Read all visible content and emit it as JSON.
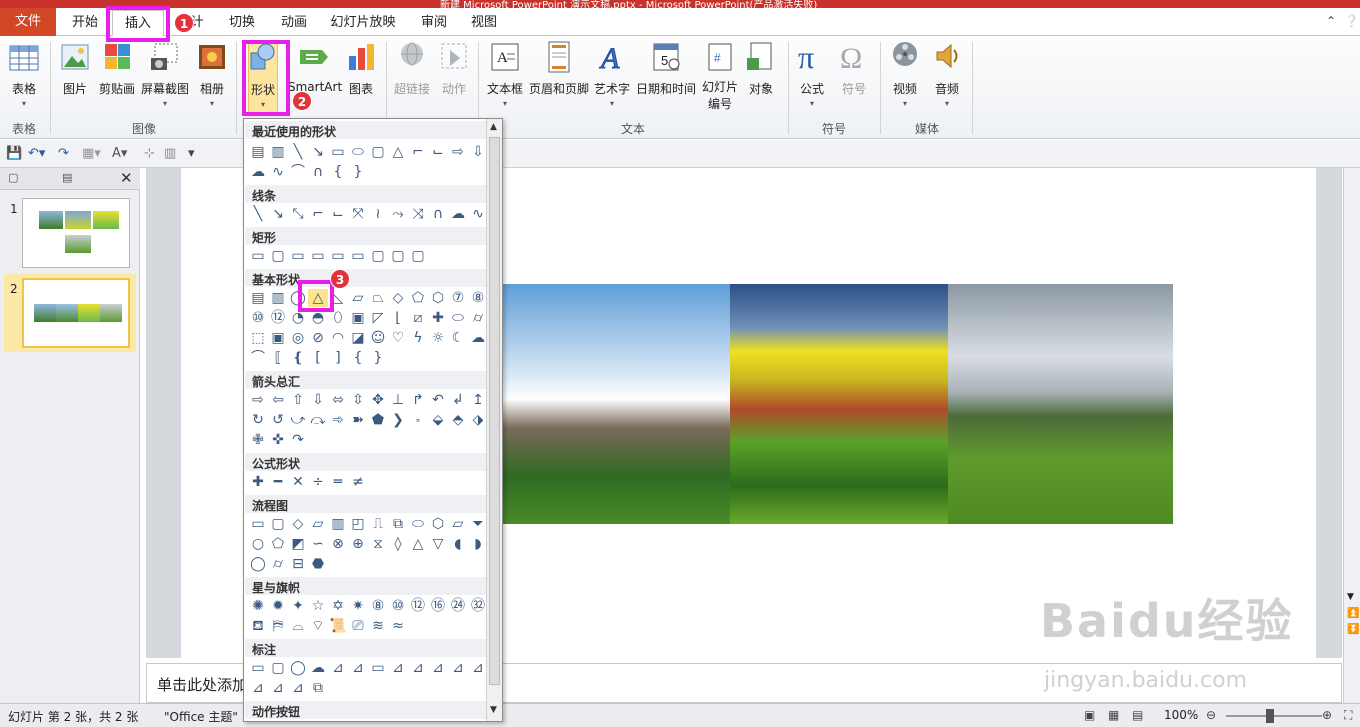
{
  "window": {
    "title": "新建 Microsoft PowerPoint 演示文稿.pptx - Microsoft PowerPoint(产品激活失败)"
  },
  "tabs": [
    "文件",
    "开始",
    "插入",
    "计",
    "切换",
    "动画",
    "幻灯片放映",
    "审阅",
    "视图"
  ],
  "ribbon": {
    "table": "表格",
    "picture": "图片",
    "clipart": "剪贴画",
    "screenshot": "屏幕截图",
    "album": "相册",
    "shapes": "形状",
    "smartart": "SmartArt",
    "chart": "图表",
    "hyperlink": "超链接",
    "action": "动作",
    "textbox": "文本框",
    "headerfooter": "页眉和页脚",
    "wordart": "艺术字",
    "datetime": "日期和时间",
    "slidenum1": "幻灯片",
    "slidenum2": "编号",
    "object": "对象",
    "equation": "公式",
    "symbol": "符号",
    "video": "视频",
    "audio": "音频",
    "groups": {
      "tables": "表格",
      "images": "图像",
      "text": "文本",
      "symbols": "符号",
      "media": "媒体"
    }
  },
  "shapes_menu": {
    "recent": "最近使用的形状",
    "lines": "线条",
    "rect": "矩形",
    "basic": "基本形状",
    "arrows": "箭头总汇",
    "equation": "公式形状",
    "flowchart": "流程图",
    "stars": "星与旗帜",
    "callouts": "标注",
    "actions": "动作按钮"
  },
  "steps": [
    "1",
    "2",
    "3"
  ],
  "slides": [
    "1",
    "2"
  ],
  "notes_placeholder": "单击此处添加",
  "status": {
    "slide_info": "幻灯片 第 2 张，共 2 张",
    "theme": "\"Office 主题\"",
    "zoom": "100%"
  },
  "watermark": {
    "brand": "Baidu经验",
    "url": "jingyan.baidu.com"
  },
  "colors": {
    "accent": "#d24726",
    "highlight": "#e81fe8",
    "badge": "#e0343a"
  }
}
